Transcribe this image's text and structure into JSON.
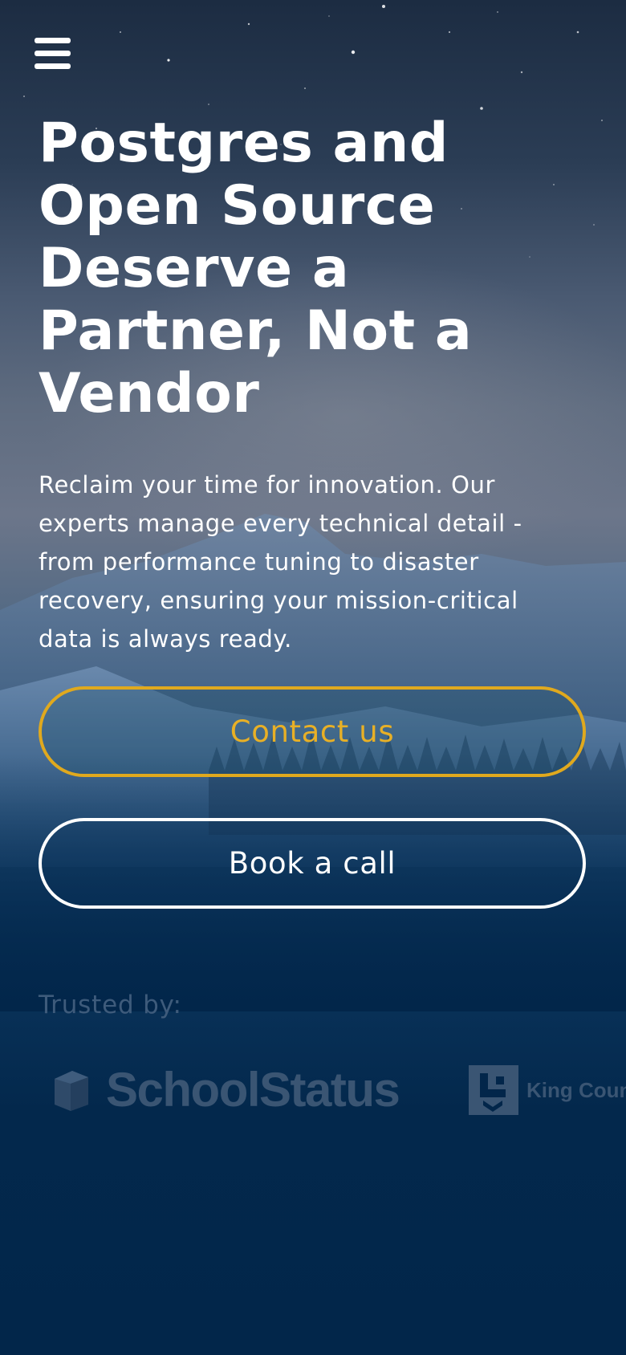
{
  "nav": {
    "menu_icon": "hamburger-menu-icon"
  },
  "hero": {
    "title": "Postgres and Open Source Deserve a Partner, Not a Vendor",
    "subtitle": "Reclaim your time for innovation. Our experts manage every technical detail - from performance tuning to disaster recovery, ensuring your mission-critical data is always ready."
  },
  "actions": {
    "contact_label": "Contact us",
    "book_label": "Book a call"
  },
  "trusted": {
    "label": "Trusted by:",
    "logos": [
      {
        "name": "SchoolStatus",
        "icon": "schoolstatus-logo"
      },
      {
        "name": "King County Library",
        "icon": "king-county-library-logo"
      }
    ]
  },
  "colors": {
    "background": "#02264a",
    "accent": "#e0a91e",
    "text": "#ffffff",
    "muted": "#3e5b7b"
  }
}
